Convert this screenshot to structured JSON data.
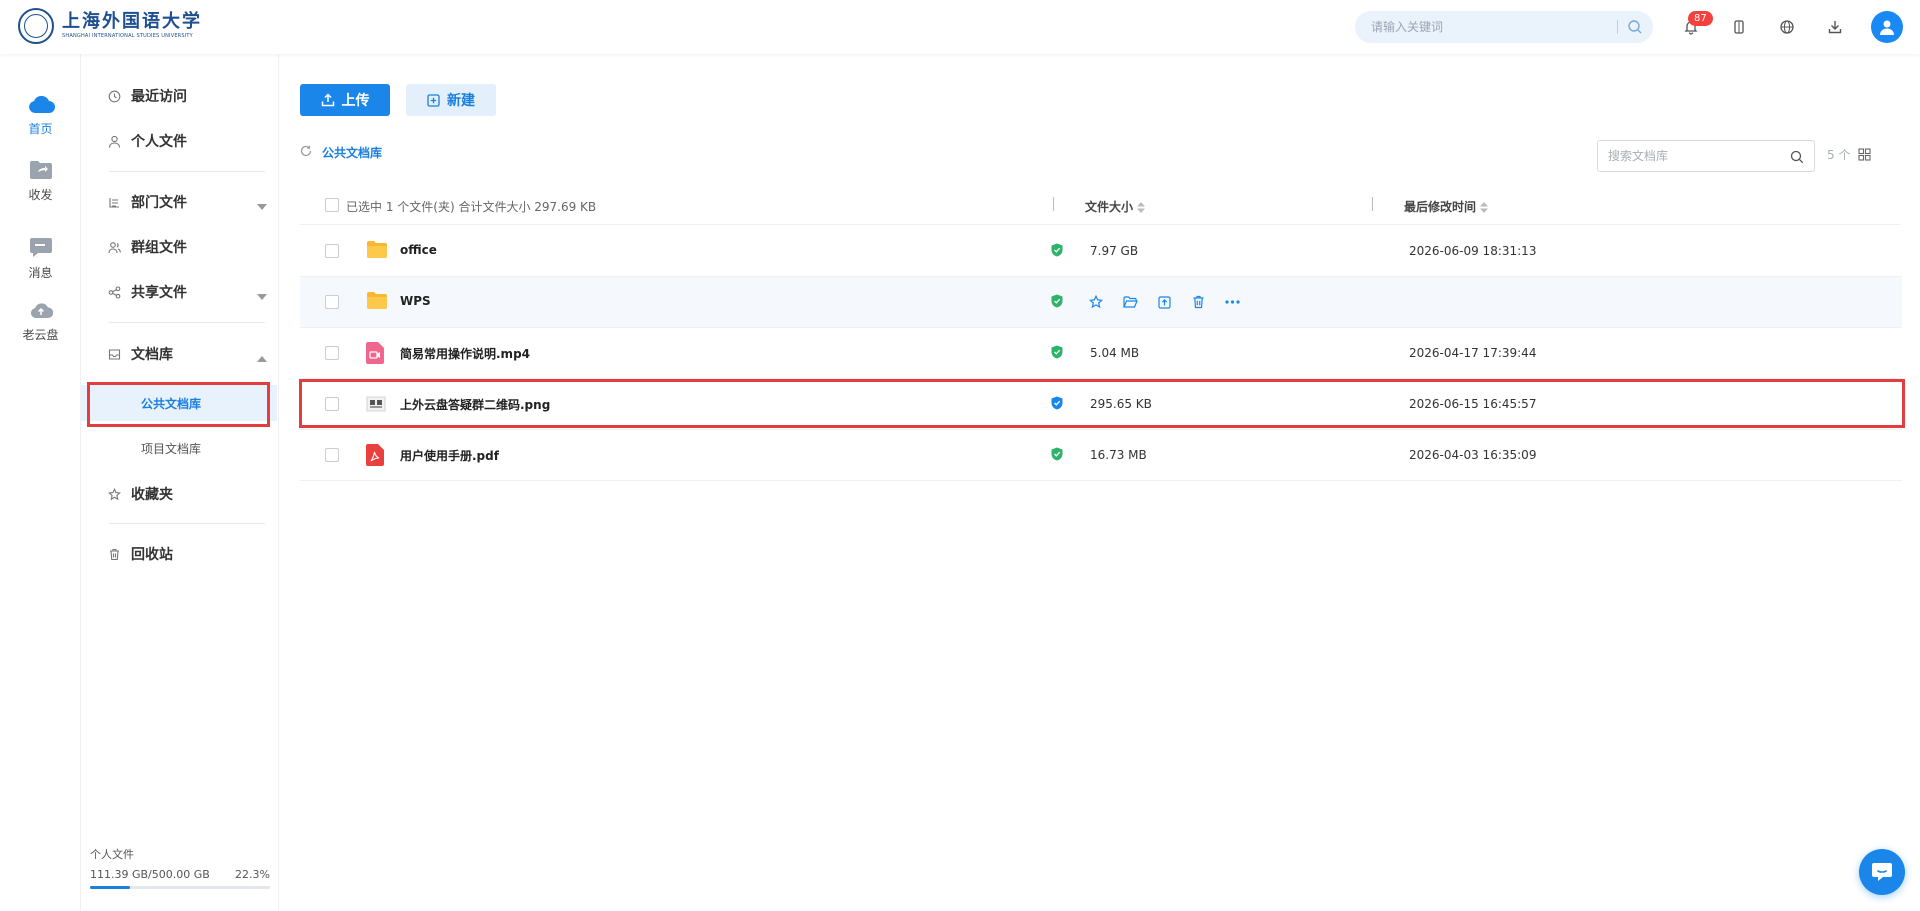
{
  "header": {
    "logo_cn": "上海外国语大学",
    "logo_en": "SHANGHAI INTERNATIONAL STUDIES UNIVERSITY",
    "search_placeholder": "请输入关键词",
    "notification_count": "87"
  },
  "left_nav": [
    {
      "label": "首页",
      "icon": "cloud-home-icon"
    },
    {
      "label": "收发",
      "icon": "share-folder-icon"
    },
    {
      "label": "消息",
      "icon": "message-icon"
    },
    {
      "label": "老云盘",
      "icon": "old-cloud-icon"
    }
  ],
  "sidebar": {
    "recent": "最近访问",
    "personal": "个人文件",
    "department": "部门文件",
    "group": "群组文件",
    "shared": "共享文件",
    "library": "文档库",
    "library_public": "公共文档库",
    "library_project": "项目文档库",
    "favorites": "收藏夹",
    "recycle": "回收站",
    "quota_label": "个人文件",
    "quota_used": "111.39 GB/500.00 GB",
    "quota_percent": "22.3%",
    "quota_fraction": 0.223
  },
  "toolbar": {
    "upload": "上传",
    "new": "新建",
    "breadcrumb": "公共文档库",
    "doc_search_placeholder": "搜索文档库",
    "count": "5 个"
  },
  "table": {
    "selection_summary": "已选中 1 个文件(夹)  合计文件大小 297.69 KB",
    "col_size": "文件大小",
    "col_modified": "最后修改时间",
    "rows": [
      {
        "name": "office",
        "type": "folder",
        "size": "7.97 GB",
        "modified": "2026-06-09 18:31:13"
      },
      {
        "name": "WPS",
        "type": "folder",
        "size": "",
        "modified": ""
      },
      {
        "name": "简易常用操作说明.mp4",
        "type": "video",
        "size": "5.04 MB",
        "modified": "2026-04-17 17:39:44"
      },
      {
        "name": "上外云盘答疑群二维码.png",
        "type": "image",
        "size": "295.65 KB",
        "modified": "2026-06-15 16:45:57"
      },
      {
        "name": "用户使用手册.pdf",
        "type": "pdf",
        "size": "16.73 MB",
        "modified": "2026-04-03 16:35:09"
      }
    ]
  },
  "colors": {
    "primary": "#1b86ea",
    "highlight": "#e43d40",
    "folder": "#f7b733",
    "shield": "#2fb36b",
    "shield_blue": "#1b86ea"
  }
}
